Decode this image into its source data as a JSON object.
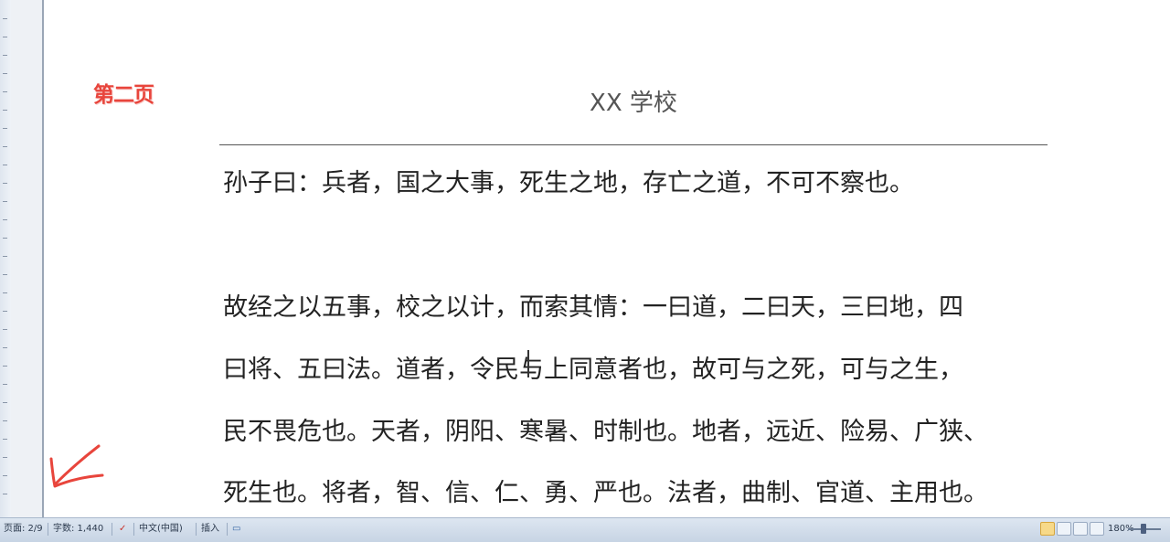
{
  "annotation": {
    "page_label": "第二页",
    "arrow_icon": "red-hand-drawn-arrow",
    "color": "#e8453c"
  },
  "document": {
    "header": "XX 学校",
    "para1": "孙子曰：兵者，国之大事，死生之地，存亡之道，不可不察也。",
    "para2_lines": [
      "故经之以五事，校之以计，而索其情：一曰道，二曰天，三曰地，四",
      "曰将、五曰法。道者，令民与上同意者也，故可与之死，可与之生，",
      "民不畏危也。天者，阴阳、寒暑、时制也。地者，远近、险易、广狭、",
      "死生也。将者，智、信、仁、勇、严也。法者，曲制、官道、主用也。"
    ]
  },
  "statusbar": {
    "page": "页面: 2/9",
    "words": "字数: 1,440",
    "language": "中文(中国)",
    "mode": "插入",
    "zoom": "180%"
  }
}
